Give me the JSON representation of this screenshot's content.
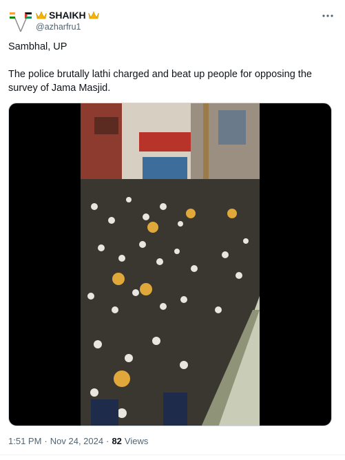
{
  "author": {
    "display_name": "SHAIKH",
    "handle": "@azharfru1",
    "avatar_icon": "crossed-flags-icon",
    "badge_icon": "crown-icon"
  },
  "tweet": {
    "location_line": "Sambhal, UP",
    "body": "The police brutally lathi charged and beat up people for opposing the survey of Jama Masjid."
  },
  "media": {
    "type": "video",
    "frame_description_icon": "video-thumbnail"
  },
  "footer": {
    "time": "1:51 PM",
    "separator": "·",
    "date": "Nov 24, 2024",
    "views_count": "82",
    "views_label": "Views"
  },
  "colors": {
    "text_primary": "#0f1419",
    "text_secondary": "#536471",
    "crown_gold": "#f5b400",
    "media_bg": "#000000"
  },
  "menu": {
    "more_icon": "more-dots-icon"
  }
}
